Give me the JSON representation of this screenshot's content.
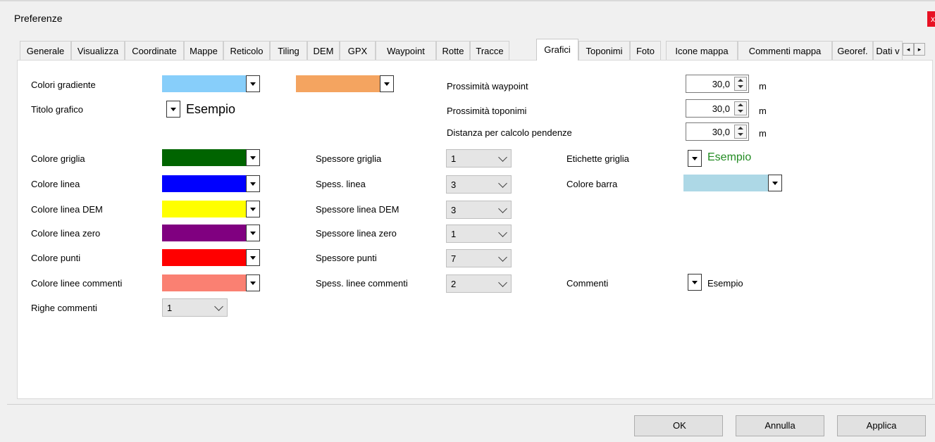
{
  "window": {
    "title": "Preferenze",
    "close_glyph": "x"
  },
  "tabs": [
    "Generale",
    "Visualizza",
    "Coordinate",
    "Mappe",
    "Reticolo",
    "Tiling",
    "DEM",
    "GPX",
    "Waypoint",
    "Rotte",
    "Tracce",
    "Grafici",
    "Toponimi",
    "Foto",
    "Icone mappa",
    "Commenti mappa",
    "Georef.",
    "Dati v"
  ],
  "active_tab": "Grafici",
  "scroll_icons": {
    "left": "◂",
    "right": "▸"
  },
  "form": {
    "gradient": {
      "label": "Colori gradiente",
      "color1": "#87cefa",
      "color2": "#f4a460"
    },
    "chart_title": {
      "label": "Titolo grafico",
      "sample": "Esempio"
    },
    "prox_waypoint": {
      "label": "Prossimità waypoint",
      "value": "30,0",
      "unit": "m"
    },
    "prox_toponimi": {
      "label": "Prossimità toponimi",
      "value": "30,0",
      "unit": "m"
    },
    "slope_distance": {
      "label": "Distanza per calcolo pendenze",
      "value": "30,0",
      "unit": "m"
    },
    "grid_color": {
      "label": "Colore griglia",
      "color": "#006400"
    },
    "line_color": {
      "label": "Colore linea",
      "color": "#0000ff"
    },
    "dem_line_color": {
      "label": "Colore linea DEM",
      "color": "#ffff00"
    },
    "zero_line_color": {
      "label": "Colore linea zero",
      "color": "#800080"
    },
    "points_color": {
      "label": "Colore punti",
      "color": "#ff0000"
    },
    "comment_lines_color": {
      "label": "Colore linee commenti",
      "color": "#fa8072"
    },
    "comment_rows": {
      "label": "Righe commenti",
      "value": "1"
    },
    "grid_width": {
      "label": "Spessore griglia",
      "value": "1"
    },
    "line_width": {
      "label": "Spess. linea",
      "value": "3"
    },
    "dem_line_width": {
      "label": "Spessore linea DEM",
      "value": "3"
    },
    "zero_line_width": {
      "label": "Spessore linea zero",
      "value": "1"
    },
    "points_width": {
      "label": "Spessore punti",
      "value": "7"
    },
    "comment_lines_width": {
      "label": "Spess. linee commenti",
      "value": "2"
    },
    "grid_labels": {
      "label": "Etichette griglia",
      "sample": "Esempio",
      "sample_color": "#228b22"
    },
    "bar_color": {
      "label": "Colore barra",
      "color": "#add8e6"
    },
    "comments": {
      "label": "Commenti",
      "sample": "Esempio"
    }
  },
  "buttons": {
    "ok": "OK",
    "cancel": "Annulla",
    "apply": "Applica"
  }
}
